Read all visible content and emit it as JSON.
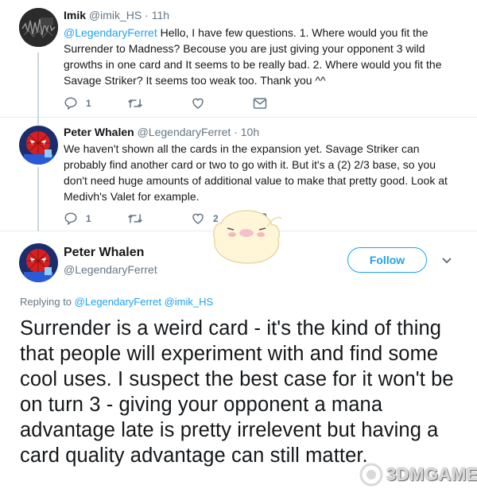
{
  "reply1": {
    "name": "Imik",
    "handle": "@imik_HS",
    "time": "11h",
    "mention": "@LegendaryFerret",
    "text": " Hello, I have few questions. 1. Where would you fit the Surrender to Madness? Becouse you are just giving your opponent 3 wild growths in one card and It seems to be really bad. 2. Where would you fit the Savage Striker? It seems too weak too. Thank you ^^",
    "reply_count": "1",
    "retweet_count": "",
    "like_count": ""
  },
  "reply2": {
    "name": "Peter Whalen",
    "handle": "@LegendaryFerret",
    "time": "10h",
    "text": "We haven't shown all the cards in the expansion yet.  Savage Striker can probably find another card or two to go with it.  But it's a (2) 2/3 base, so you don't need huge amounts of additional value to make that pretty good.  Look at Medivh's Valet for example.",
    "reply_count": "1",
    "retweet_count": "",
    "like_count": "2"
  },
  "main": {
    "name": "Peter Whalen",
    "handle": "@LegendaryFerret",
    "follow_label": "Follow",
    "replying_prefix": "Replying to ",
    "replying_to_1": "@LegendaryFerret",
    "replying_to_2": "@imik_HS",
    "text": "Surrender is a weird card - it's the kind of thing that people will experiment with and find some cool uses.  I suspect the best case for it won't be on turn 3 - giving your opponent a mana advantage late is pretty irrelevent but having a card quality advantage can still matter."
  },
  "watermark": {
    "text": "3DMGAME"
  },
  "colors": {
    "accent": "#1da1f2",
    "secondary_text": "#657786",
    "divider": "#e6ecf0"
  },
  "icons": {
    "reply": "reply-icon",
    "retweet": "retweet-icon",
    "like": "heart-icon",
    "message": "envelope-icon",
    "more": "chevron-down-icon"
  }
}
